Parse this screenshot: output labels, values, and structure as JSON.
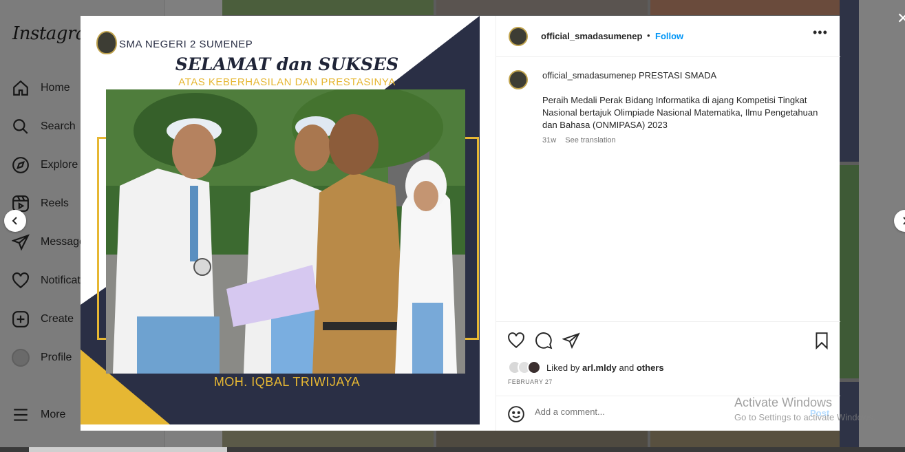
{
  "sidebar": {
    "logo": "Instagram",
    "items": [
      {
        "label": "Home",
        "icon": "home-icon"
      },
      {
        "label": "Search",
        "icon": "search-icon"
      },
      {
        "label": "Explore",
        "icon": "explore-icon"
      },
      {
        "label": "Reels",
        "icon": "reels-icon"
      },
      {
        "label": "Message",
        "icon": "messages-icon"
      },
      {
        "label": "Notificat",
        "icon": "heart-icon"
      },
      {
        "label": "Create",
        "icon": "plus-square-icon"
      },
      {
        "label": "Profile",
        "icon": "profile-avatar"
      }
    ],
    "more_label": "More"
  },
  "post": {
    "image": {
      "school_name": "SMA NEGERI 2 SUMENEP",
      "headline": "SELAMAT dan SUKSES",
      "subline": "ATAS KEBERHASILAN DAN PRESTASINYA",
      "student_name": "MOH. IQBAL TRIWIJAYA"
    },
    "header": {
      "username": "official_smadasumenep",
      "dot": "•",
      "follow_label": "Follow",
      "more_label": "•••"
    },
    "caption": {
      "username": "official_smadasumenep",
      "title": "PRESTASI SMADA",
      "body": "Peraih Medali Perak Bidang Informatika di ajang Kompetisi Tingkat Nasional bertajuk Olimpiade Nasional Matematika, Ilmu Pengetahuan dan Bahasa (ONMIPASA) 2023",
      "age": "31w",
      "see_translation": "See translation"
    },
    "likes": {
      "prefix": "Liked by",
      "user": "arl.mldy",
      "and": "and",
      "others": "others"
    },
    "date": "FEBRUARY 27",
    "comment": {
      "placeholder": "Add a comment...",
      "post_label": "Post"
    }
  },
  "watermark": {
    "line1": "Activate Windows",
    "line2": "Go to Settings to activate Windows."
  },
  "colors": {
    "navy": "#2a2f45",
    "gold": "#e6b733",
    "link_blue": "#0095f6"
  }
}
